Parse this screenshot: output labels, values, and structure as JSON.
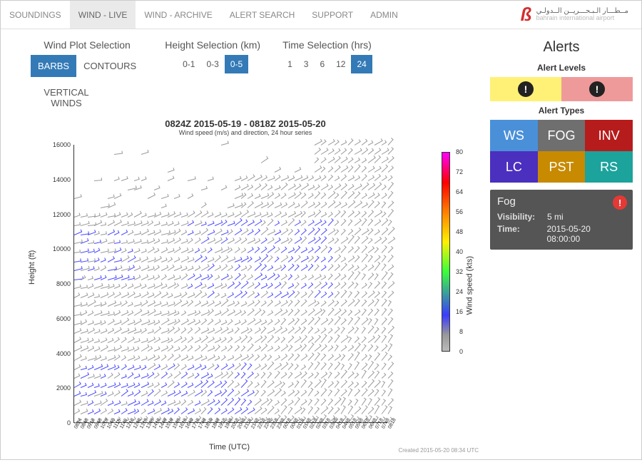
{
  "nav": {
    "items": [
      "SOUNDINGS",
      "WIND - LIVE",
      "WIND - ARCHIVE",
      "ALERT SEARCH",
      "SUPPORT",
      "ADMIN"
    ],
    "active_index": 1
  },
  "branding": {
    "arabic": "مــطـــار الـبـحـــريــن الــدولـي",
    "eng": "bahrain international airport"
  },
  "controls": {
    "plot_selection": {
      "title": "Wind Plot Selection",
      "options": [
        "BARBS",
        "CONTOURS"
      ],
      "extra": "VERTICAL WINDS",
      "active_index": 0
    },
    "height_selection": {
      "title": "Height Selection (km)",
      "options": [
        "0-1",
        "0-3",
        "0-5"
      ],
      "active_index": 2
    },
    "time_selection": {
      "title": "Time Selection (hrs)",
      "options": [
        "1",
        "3",
        "6",
        "12",
        "24"
      ],
      "active_index": 4
    }
  },
  "chart": {
    "title": "0824Z 2015-05-19 - 0818Z 2015-05-20",
    "subtitle": "Wind speed (m/s) and direction, 24 hour series",
    "ylabel": "Height (ft)",
    "xlabel": "Time (UTC)",
    "yticks": [
      "0",
      "2000",
      "4000",
      "6000",
      "8000",
      "10000",
      "12000",
      "14000",
      "16000"
    ],
    "xticks": [
      "0824",
      "0848",
      "0918",
      "0948",
      "1018",
      "1048",
      "1118",
      "1148",
      "1218",
      "1248",
      "1318",
      "1348",
      "1418",
      "1448",
      "1518",
      "1548",
      "1618",
      "1648",
      "1718",
      "1748",
      "1818",
      "1848",
      "1918",
      "1948",
      "2018",
      "2048",
      "2118",
      "2148",
      "2218",
      "2248",
      "2318",
      "2348",
      "0018",
      "0048",
      "0118",
      "0148",
      "0218",
      "0248",
      "0318",
      "0348",
      "0418",
      "0448",
      "0518",
      "0548",
      "0618",
      "0648",
      "0718",
      "0748",
      "0818"
    ],
    "colorbar": {
      "label": "Wind speed (kts)",
      "ticks": [
        "0",
        "8",
        "16",
        "24",
        "32",
        "40",
        "48",
        "56",
        "64",
        "72",
        "80"
      ]
    },
    "created": "Created 2015-05-20 08:34 UTC"
  },
  "chart_data": {
    "type": "barb-field",
    "y_axis": {
      "label": "Height (ft)",
      "range": [
        0,
        16500
      ]
    },
    "x_axis": {
      "label": "Time (UTC)",
      "range_hours": 24
    },
    "color_scale": {
      "label": "Wind speed (kts)",
      "range": [
        0,
        80
      ]
    },
    "note": "Dense grid of wind barbs; blue barbs ≈ 15–20 kts concentrated at low levels (~1000–3000 ft) early period and mid-levels (~8000–12000 ft) through middle of series; gray barbs ≈ 5–10 kts elsewhere; sparse above 14000 ft early, filling in later."
  },
  "alerts": {
    "title": "Alerts",
    "levels_label": "Alert Levels",
    "types_label": "Alert Types",
    "types": [
      {
        "code": "WS",
        "color": "c-ws"
      },
      {
        "code": "FOG",
        "color": "c-fog"
      },
      {
        "code": "INV",
        "color": "c-inv"
      },
      {
        "code": "LC",
        "color": "c-lc"
      },
      {
        "code": "PST",
        "color": "c-pst"
      },
      {
        "code": "RS",
        "color": "c-rs"
      }
    ],
    "active": {
      "name": "Fog",
      "visibility_label": "Visibility:",
      "visibility_value": "5 mi",
      "time_label": "Time:",
      "time_value": "2015-05-20 08:00:00"
    }
  }
}
